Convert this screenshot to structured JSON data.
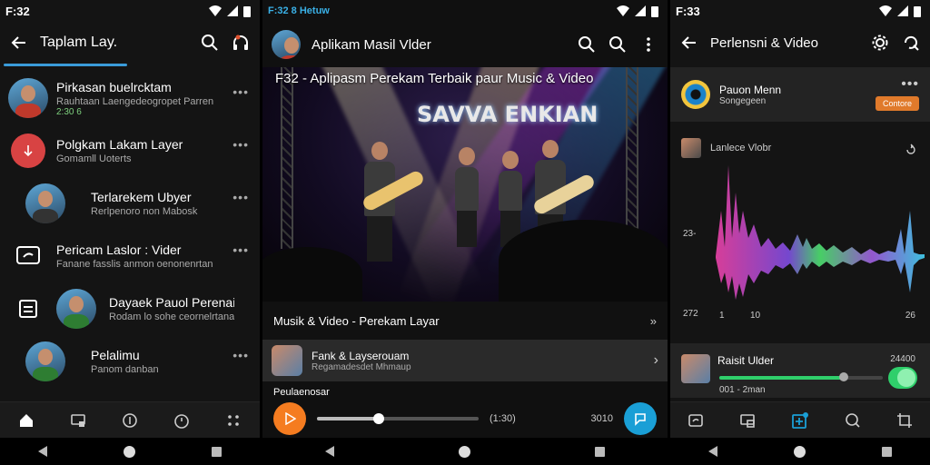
{
  "panel1": {
    "status_time": "F:32",
    "title": "Taplam Lay.",
    "items": [
      {
        "title": "Pirkasan buelrcktam",
        "subtitle": "Rauhtaan Laengedeogropet Parren",
        "meta": "2:30 6"
      },
      {
        "title": "Polgkam Lakam Layer",
        "subtitle": "Gomamll Uoterts"
      },
      {
        "title": "Terlarekem Ubyer",
        "subtitle": "Rerlpenoro non Mabosk"
      },
      {
        "title": "Pericam Laslor : Vider",
        "subtitle": "Fanane fasslis anmon oenonenrtan"
      },
      {
        "title": "Dayaek Pauol Perenain",
        "subtitle": "Rodam lo sohe ceornelrtanain"
      },
      {
        "title": "Pelalimu",
        "subtitle": "Panom danban"
      }
    ],
    "more_label": "•••"
  },
  "panel2": {
    "status_time": "F:32 8 Hetuw",
    "title": "Aplikam Masil Vlder",
    "overlay_title": "F32 - Aplipasm Perekam Terbaik paur Music & Video",
    "banner": "SAVVA ENKIAN",
    "section_title": "Musik & Video - Perekam Layar",
    "track1": {
      "title": "Fank & Layserouam",
      "subtitle": "Regamadesdet Mhmaup"
    },
    "track2": {
      "title": "Peulaenosar"
    },
    "player": {
      "time": "(1:30)",
      "count": "3010",
      "progress": 0.38
    }
  },
  "panel3": {
    "status_time": "F:33",
    "title": "Perlensni & Video",
    "now": {
      "title": "Pauon Menn",
      "subtitle": "Songegeen",
      "button": "Contore",
      "more": "•••"
    },
    "wave": {
      "heading": "Lanlece Vlobr",
      "y_label": "23-",
      "y_label_low": "272",
      "x_labels": [
        "1",
        "10"
      ],
      "x_right": "26"
    },
    "row": {
      "title": "Raisit Ulder",
      "right": "24400",
      "time": "001 - 2man",
      "progress": 0.76
    }
  },
  "colors": {
    "accent_blue": "#1a9fd6",
    "accent_orange": "#f57c20",
    "accent_green": "#2fcf6b"
  }
}
